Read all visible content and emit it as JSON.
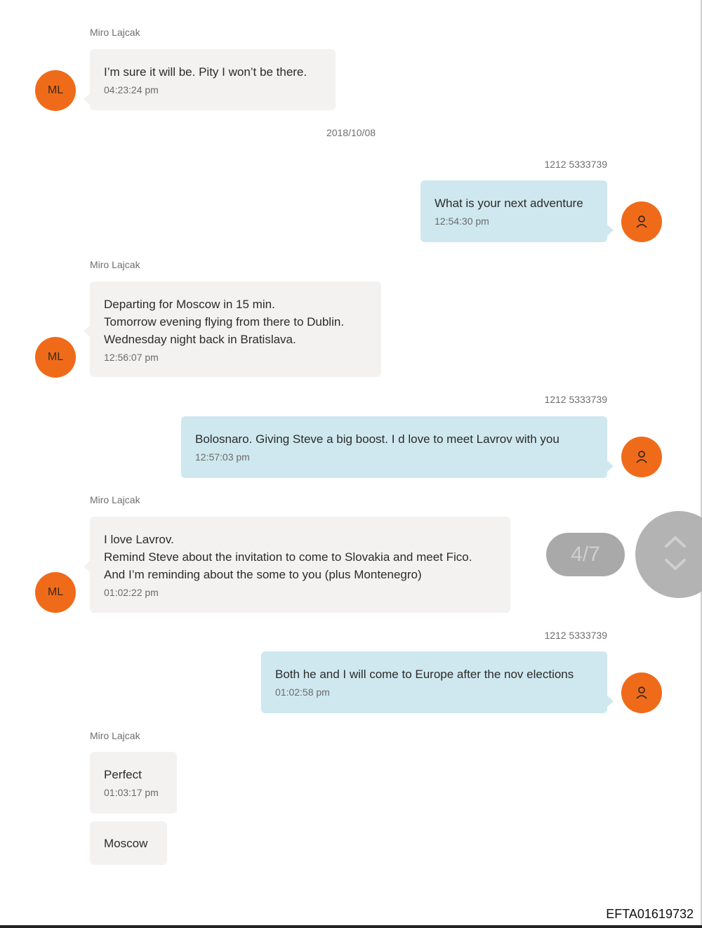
{
  "messages": [
    {
      "sender": "Miro Lajcak",
      "avatar": "ML",
      "text": "I’m sure it will be. Pity I won’t be there.",
      "time": "04:23:24 pm"
    },
    {
      "date": "2018/10/08"
    },
    {
      "sender": "1212 5333739",
      "avatar_icon": "person-icon",
      "text": "What is your next adventure",
      "time": "12:54:30 pm"
    },
    {
      "sender": "Miro Lajcak",
      "avatar": "ML",
      "text": "Departing for Moscow in 15 min.\nTomorrow evening flying from there to Dublin.\nWednesday night back in Bratislava.",
      "time": "12:56:07 pm"
    },
    {
      "sender": "1212 5333739",
      "avatar_icon": "person-icon",
      "text": "Bolosnaro. Giving Steve a big boost.     I d love to meet Lavrov with you",
      "time": "12:57:03 pm"
    },
    {
      "sender": "Miro Lajcak",
      "avatar": "ML",
      "text": "I love Lavrov.\nRemind Steve about the invitation to come to Slovakia and meet Fico.\nAnd I’m reminding about the some to you (plus Montenegro)",
      "time": "01:02:22 pm"
    },
    {
      "sender": "1212 5333739",
      "avatar_icon": "person-icon",
      "text": "Both he and I will come to Europe after the nov elections",
      "time": "01:02:58 pm"
    },
    {
      "sender": "Miro Lajcak",
      "text": "Perfect",
      "time": "01:03:17 pm"
    },
    {
      "text": "Moscow"
    }
  ],
  "pager": {
    "label": "4/7"
  },
  "footer": {
    "doc_id": "EFTA01619732"
  },
  "colors": {
    "avatar": "#ef6b1a",
    "incoming_bubble": "#f4f2f1",
    "outgoing_bubble": "#cfe8ef"
  }
}
